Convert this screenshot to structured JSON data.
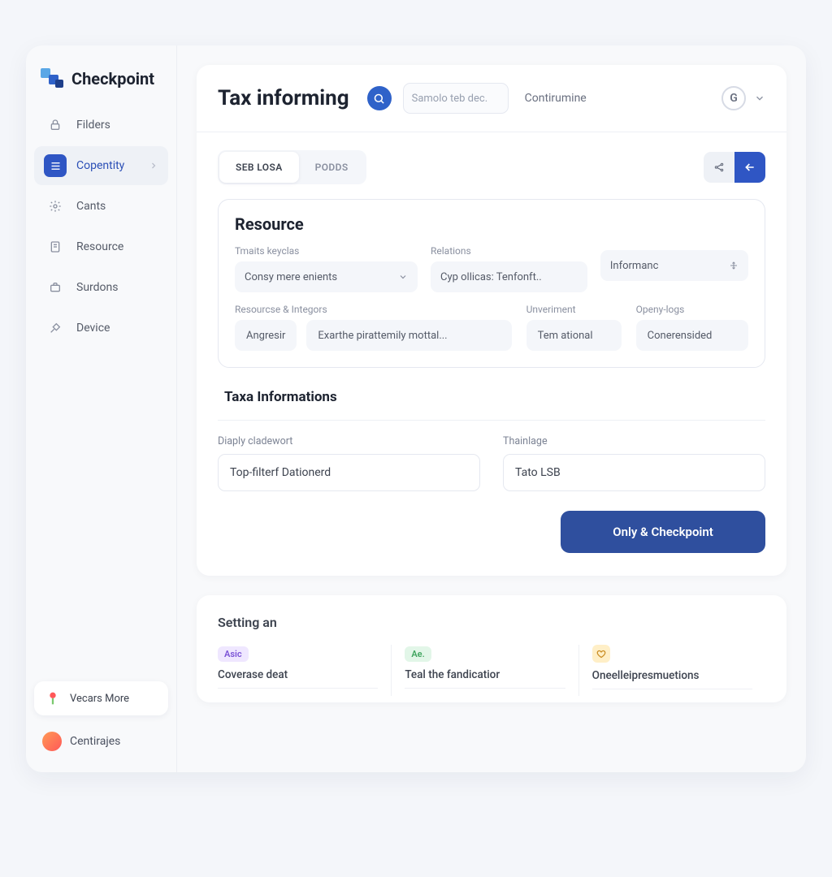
{
  "brand": "Checkpoint",
  "sidebar": {
    "items": [
      {
        "label": "Filders"
      },
      {
        "label": "Copentity"
      },
      {
        "label": "Cants"
      },
      {
        "label": "Resource"
      },
      {
        "label": "Surdons"
      },
      {
        "label": "Device"
      }
    ],
    "promo": "Vecars More",
    "user": "Centirajes"
  },
  "header": {
    "title": "Tax informing",
    "search_placeholder": "Samolo teb dec.",
    "link": "Contirumine",
    "g": "G"
  },
  "tabs": [
    {
      "label": "SEB LOSA"
    },
    {
      "label": "PODDS"
    }
  ],
  "resource": {
    "title": "Resource",
    "fields": {
      "f1_label": "Tmaits keyclas",
      "f1_value": "Consy mere enients",
      "f2_label": "Relations",
      "f2_value": "Cyp ollicas: Tenfonft..",
      "f3_label": "",
      "f3_value": "Informanc"
    },
    "row2_label1": "Resourcse & Integors",
    "row2_label2": "Unveriment",
    "row2_label3": "Openy-logs",
    "chips": {
      "c1": "Angresir",
      "c2": "Exarthe pirattemily mottal...",
      "c3": "Tem ational",
      "c4": "Conerensided"
    }
  },
  "taxa": {
    "title": "Taxa Informations",
    "f1_label": "Diaply cladewort",
    "f1_value": "Top-filterf Dationerd",
    "f2_label": "Thainlage",
    "f2_value": "Tato LSB",
    "button": "Only & Checkpoint"
  },
  "settings": {
    "title": "Setting an",
    "cols": [
      {
        "badge": "Asic",
        "title": "Coverase deat"
      },
      {
        "badge": "Ae.",
        "title": "Teal the fandicatior"
      },
      {
        "badge": "♡",
        "title": "Oneelleipresmuetions"
      }
    ]
  }
}
